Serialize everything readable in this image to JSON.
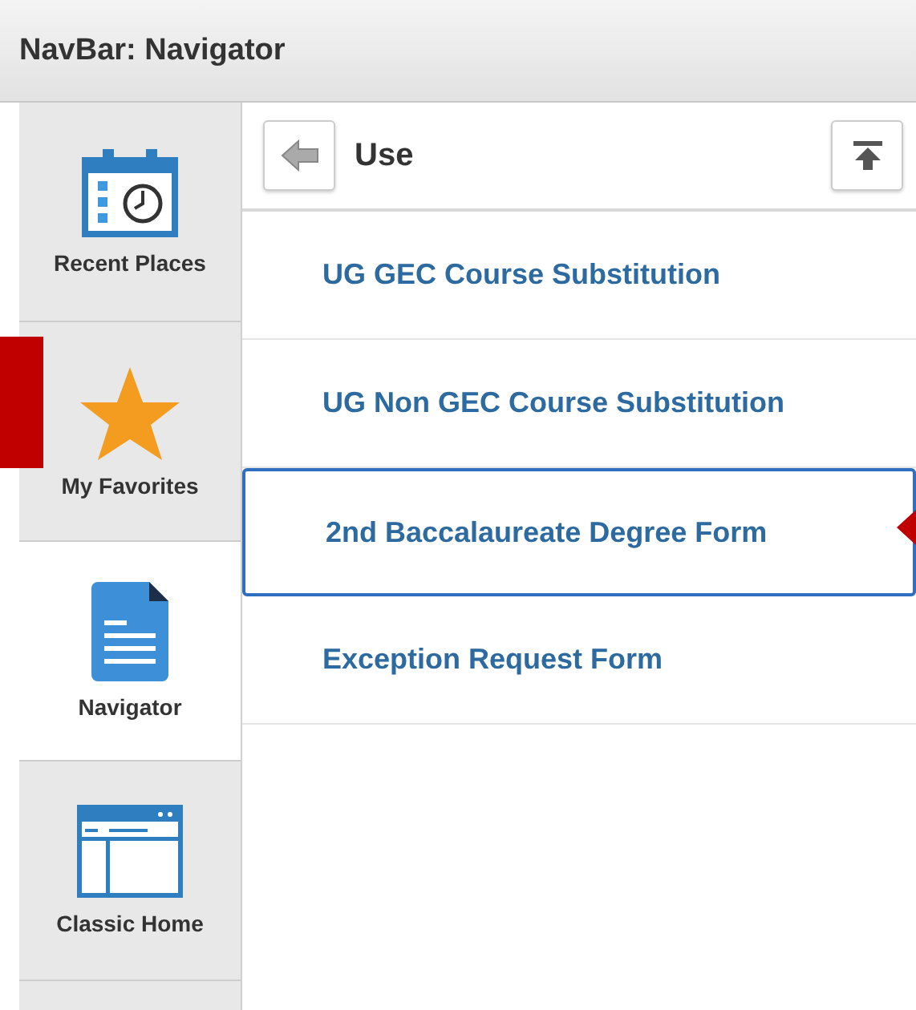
{
  "header": {
    "title": "NavBar: Navigator"
  },
  "tabs": [
    {
      "label": "Recent Places",
      "kind": "recent",
      "selected": false
    },
    {
      "label": "My Favorites",
      "kind": "favorites",
      "selected": false
    },
    {
      "label": "Navigator",
      "kind": "navigator",
      "selected": true
    },
    {
      "label": "Classic Home",
      "kind": "classic",
      "selected": false
    }
  ],
  "panel": {
    "title": "Use"
  },
  "items": [
    {
      "label": "UG GEC Course Substitution",
      "selected": false
    },
    {
      "label": "UG Non GEC Course Substitution",
      "selected": false
    },
    {
      "label": "2nd Baccalaureate Degree Form",
      "selected": true
    },
    {
      "label": "Exception Request Form",
      "selected": false
    }
  ]
}
